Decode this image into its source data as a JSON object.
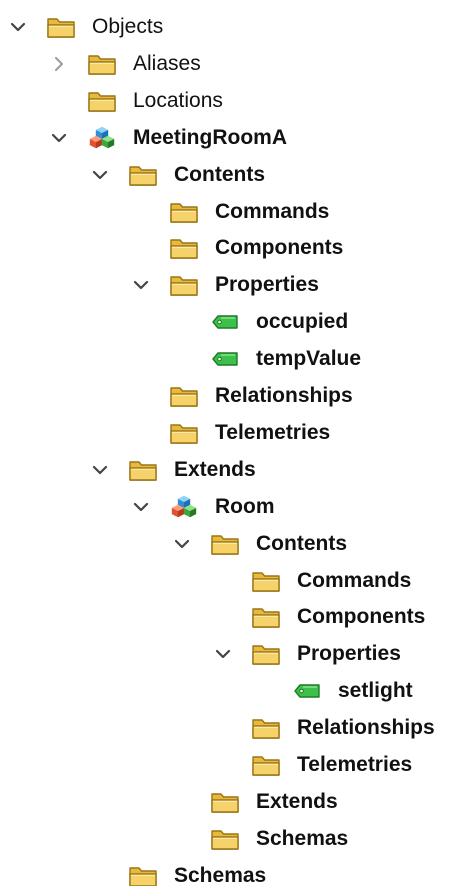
{
  "colors": {
    "folder_fill": "#f5d36a",
    "folder_stroke": "#9a7415",
    "tag_fill": "#3cc04a",
    "tag_stroke": "#1f7a28",
    "arrow": "#444444",
    "arrow_collapsed": "#a0a0a0"
  },
  "tree": [
    {
      "label": "Objects",
      "icon": "folder-icon",
      "level": 0,
      "state": "expanded",
      "bold": false
    },
    {
      "label": "Aliases",
      "icon": "folder-icon",
      "level": 1,
      "state": "collapsed",
      "bold": false
    },
    {
      "label": "Locations",
      "icon": "folder-icon",
      "level": 1,
      "state": "none",
      "bold": false
    },
    {
      "label": "MeetingRoomA",
      "icon": "model-cubes-icon",
      "level": 1,
      "state": "expanded",
      "bold": true
    },
    {
      "label": "Contents",
      "icon": "folder-icon",
      "level": 2,
      "state": "expanded",
      "bold": true
    },
    {
      "label": "Commands",
      "icon": "folder-icon",
      "level": 3,
      "state": "none",
      "bold": true
    },
    {
      "label": "Components",
      "icon": "folder-icon",
      "level": 3,
      "state": "none",
      "bold": true
    },
    {
      "label": "Properties",
      "icon": "folder-icon",
      "level": 3,
      "state": "expanded",
      "bold": true
    },
    {
      "label": "occupied",
      "icon": "property-tag-icon",
      "level": 4,
      "state": "none",
      "bold": true
    },
    {
      "label": "tempValue",
      "icon": "property-tag-icon",
      "level": 4,
      "state": "none",
      "bold": true
    },
    {
      "label": "Relationships",
      "icon": "folder-icon",
      "level": 3,
      "state": "none",
      "bold": true
    },
    {
      "label": "Telemetries",
      "icon": "folder-icon",
      "level": 3,
      "state": "none",
      "bold": true
    },
    {
      "label": "Extends",
      "icon": "folder-icon",
      "level": 2,
      "state": "expanded",
      "bold": true
    },
    {
      "label": "Room",
      "icon": "model-cubes-icon",
      "level": 3,
      "state": "expanded",
      "bold": true
    },
    {
      "label": "Contents",
      "icon": "folder-icon",
      "level": 4,
      "state": "expanded",
      "bold": true
    },
    {
      "label": "Commands",
      "icon": "folder-icon",
      "level": 5,
      "state": "none",
      "bold": true
    },
    {
      "label": "Components",
      "icon": "folder-icon",
      "level": 5,
      "state": "none",
      "bold": true
    },
    {
      "label": "Properties",
      "icon": "folder-icon",
      "level": 5,
      "state": "expanded",
      "bold": true
    },
    {
      "label": "setlight",
      "icon": "property-tag-icon",
      "level": 6,
      "state": "none",
      "bold": true
    },
    {
      "label": "Relationships",
      "icon": "folder-icon",
      "level": 5,
      "state": "none",
      "bold": true
    },
    {
      "label": "Telemetries",
      "icon": "folder-icon",
      "level": 5,
      "state": "none",
      "bold": true
    },
    {
      "label": "Extends",
      "icon": "folder-icon",
      "level": 4,
      "state": "none",
      "bold": true
    },
    {
      "label": "Schemas",
      "icon": "folder-icon",
      "level": 4,
      "state": "none",
      "bold": true
    },
    {
      "label": "Schemas",
      "icon": "folder-icon",
      "level": 2,
      "state": "none",
      "bold": true
    }
  ]
}
